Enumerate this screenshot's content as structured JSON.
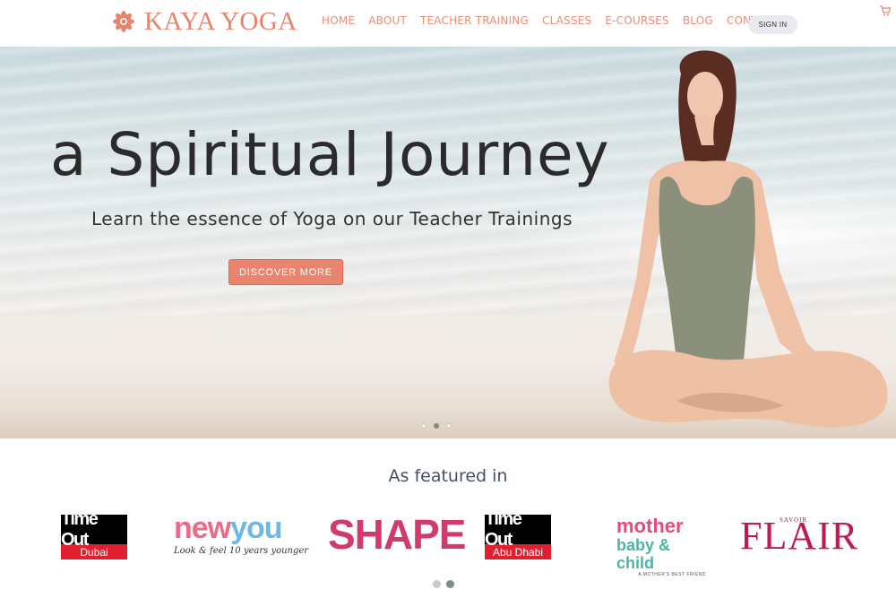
{
  "header": {
    "brand": "KAYA YOGA",
    "nav": [
      "HOME",
      "ABOUT",
      "TEACHER TRAINING",
      "CLASSES",
      "E-COURSES",
      "BLOG",
      "CONTACT"
    ],
    "signin": "SIGN IN",
    "cart_icon": "cart-icon"
  },
  "hero": {
    "title": "a Spiritual Journey",
    "subtitle": "Learn the essence of Yoga on our Teacher Trainings",
    "button": "DISCOVER MORE",
    "slides": 3,
    "active_slide": 1
  },
  "featured": {
    "title": "As featured in",
    "logos": [
      {
        "top": "Time Out",
        "bottom": "Dubai"
      },
      {
        "new": "new",
        "you": "you",
        "tagline": "Look & feel 10 years younger"
      },
      {
        "text": "SHAPE"
      },
      {
        "top": "Time Out",
        "bottom": "Abu Dhabi"
      },
      {
        "line1": "mother",
        "line2": "baby & child",
        "line3": "A MOTHER'S BEST FRIEND"
      },
      {
        "savoir": "SAVOIR",
        "text": "FLAIR"
      }
    ],
    "pages": 2,
    "active_page": 1
  },
  "colors": {
    "brand": "#e8846b",
    "button": "#e9846e",
    "featured_text": "#44506a"
  }
}
